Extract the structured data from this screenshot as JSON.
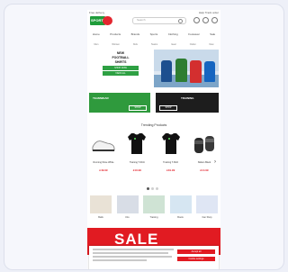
{
  "topbar": {
    "left": "Free delivery",
    "right": "Help  Track order"
  },
  "header": {
    "logo": "SPORT",
    "search_placeholder": "Search"
  },
  "nav": [
    "Home",
    "Products",
    "Brands",
    "Sports",
    "Clothing",
    "Footwear",
    "Sale"
  ],
  "categories": [
    "Men",
    "Women",
    "Kids",
    "Teams",
    "Gear",
    "Outlet",
    "New"
  ],
  "hero": {
    "line1": "NEW",
    "line2": "FOOTBALL",
    "line3": "SHIRTS",
    "button1": "SHOP NOW",
    "button2": "VIEW ALL"
  },
  "promos": [
    {
      "label": "TEAMWEAR",
      "button": "SHOP"
    },
    {
      "label": "TRAINING",
      "button": "SHOP"
    }
  ],
  "section_title": "Trending Products",
  "products": [
    {
      "name": "Running Shoe White",
      "price": "£49.99",
      "kind": "shoe"
    },
    {
      "name": "Training T-Shirt",
      "price": "£19.99",
      "kind": "shirt"
    },
    {
      "name": "Training T-Shirt",
      "price": "£19.99",
      "kind": "shirt"
    },
    {
      "name": "Sliders Black",
      "price": "£14.99",
      "kind": "slide"
    }
  ],
  "tiles": [
    {
      "caption": "Balls"
    },
    {
      "caption": "Kits"
    },
    {
      "caption": "Training"
    },
    {
      "caption": "Boots"
    },
    {
      "caption": "Fan Shop"
    }
  ],
  "sale": {
    "text": "SALE"
  },
  "cookie": {
    "accept": "Accept all",
    "settings": "Cookie settings"
  },
  "colors": {
    "brand_green": "#1f9c3a",
    "brand_red": "#e3262f",
    "sale_red": "#e11b22"
  }
}
